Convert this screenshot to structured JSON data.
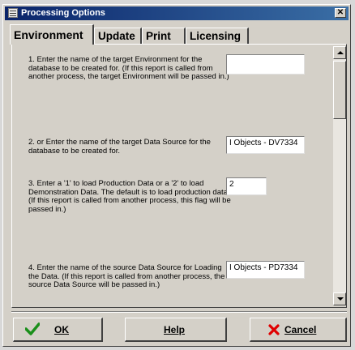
{
  "window": {
    "title": "Processing Options",
    "close_label": "✕"
  },
  "tabs": [
    {
      "label": "Environment"
    },
    {
      "label": "Update"
    },
    {
      "label": "Print"
    },
    {
      "label": "Licensing"
    }
  ],
  "questions": [
    {
      "text": "1.  Enter the name of the target Environment for the database to be created for.  (If this report is called from another process, the target Environment will be passed in.)",
      "value": ""
    },
    {
      "text": "2.  or Enter the name of the target Data Source for the database to be created for.",
      "value": "I Objects - DV7334"
    },
    {
      "text": "3.  Enter a '1' to load Production Data or a '2' to load Demonstration Data.  The default is to load production data.  (If this report is called from another process, this flag will be passed in.)",
      "value": "2"
    },
    {
      "text": "4.  Enter the name of the source Data Source for Loading the Data.  (If this report is called from another process, the source Data Source will be passed in.)",
      "value": "I Objects - PD7334"
    }
  ],
  "buttons": {
    "ok": "OK",
    "help": "Help",
    "cancel": "Cancel"
  },
  "colors": {
    "titlebar": "#0a246a",
    "check": "#1a8f1a",
    "cancel_x": "#e00000"
  }
}
